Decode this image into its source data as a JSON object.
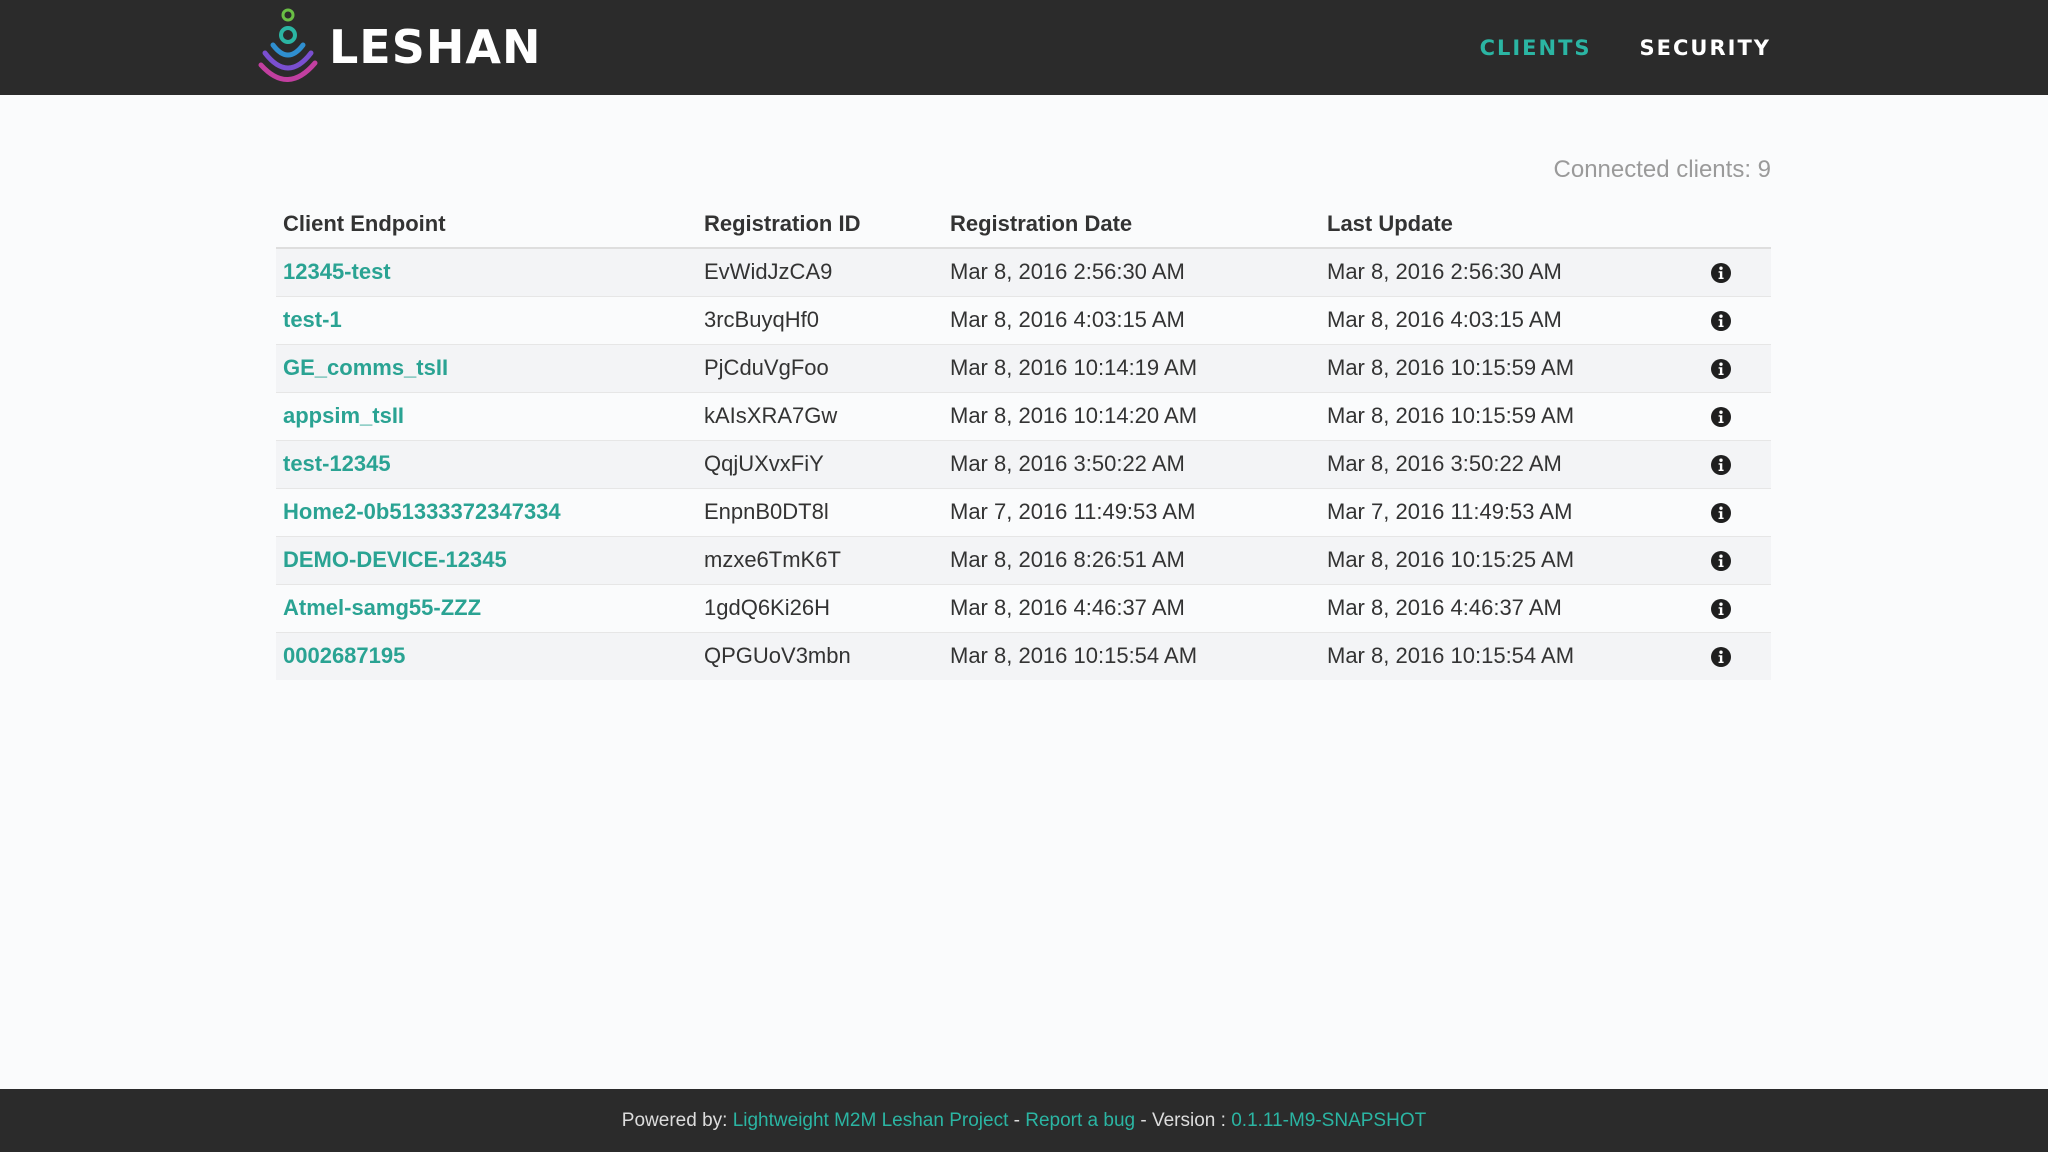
{
  "brand": {
    "name": "LESHAN"
  },
  "nav": {
    "clients": "CLIENTS",
    "security": "SECURITY"
  },
  "connected_text": "Connected clients: 9",
  "table": {
    "headers": [
      "Client Endpoint",
      "Registration ID",
      "Registration Date",
      "Last Update"
    ],
    "rows": [
      {
        "endpoint": "12345-test",
        "reg_id": "EvWidJzCA9",
        "reg_date": "Mar 8, 2016 2:56:30 AM",
        "last_update": "Mar 8, 2016 2:56:30 AM"
      },
      {
        "endpoint": "test-1",
        "reg_id": "3rcBuyqHf0",
        "reg_date": "Mar 8, 2016 4:03:15 AM",
        "last_update": "Mar 8, 2016 4:03:15 AM"
      },
      {
        "endpoint": "GE_comms_tsII",
        "reg_id": "PjCduVgFoo",
        "reg_date": "Mar 8, 2016 10:14:19 AM",
        "last_update": "Mar 8, 2016 10:15:59 AM"
      },
      {
        "endpoint": "appsim_tsII",
        "reg_id": "kAIsXRA7Gw",
        "reg_date": "Mar 8, 2016 10:14:20 AM",
        "last_update": "Mar 8, 2016 10:15:59 AM"
      },
      {
        "endpoint": "test-12345",
        "reg_id": "QqjUXvxFiY",
        "reg_date": "Mar 8, 2016 3:50:22 AM",
        "last_update": "Mar 8, 2016 3:50:22 AM"
      },
      {
        "endpoint": "Home2-0b51333372347334",
        "reg_id": "EnpnB0DT8l",
        "reg_date": "Mar 7, 2016 11:49:53 AM",
        "last_update": "Mar 7, 2016 11:49:53 AM"
      },
      {
        "endpoint": "DEMO-DEVICE-12345",
        "reg_id": "mzxe6TmK6T",
        "reg_date": "Mar 8, 2016 8:26:51 AM",
        "last_update": "Mar 8, 2016 10:15:25 AM"
      },
      {
        "endpoint": "Atmel-samg55-ZZZ",
        "reg_id": "1gdQ6Ki26H",
        "reg_date": "Mar 8, 2016 4:46:37 AM",
        "last_update": "Mar 8, 2016 4:46:37 AM"
      },
      {
        "endpoint": "0002687195",
        "reg_id": "QPGUoV3mbn",
        "reg_date": "Mar 8, 2016 10:15:54 AM",
        "last_update": "Mar 8, 2016 10:15:54 AM"
      }
    ],
    "row_icon": "info-circle-icon"
  },
  "footer": {
    "powered_by": "Powered by: ",
    "project_link": "Lightweight M2M Leshan Project",
    "sep1": " - ",
    "bug_link": "Report a bug",
    "sep2": " - Version : ",
    "version_link": "0.1.11-M9-SNAPSHOT"
  },
  "colors": {
    "accent": "#2bb5a3",
    "navbar": "#2b2b2b",
    "link": "#2aa393"
  }
}
